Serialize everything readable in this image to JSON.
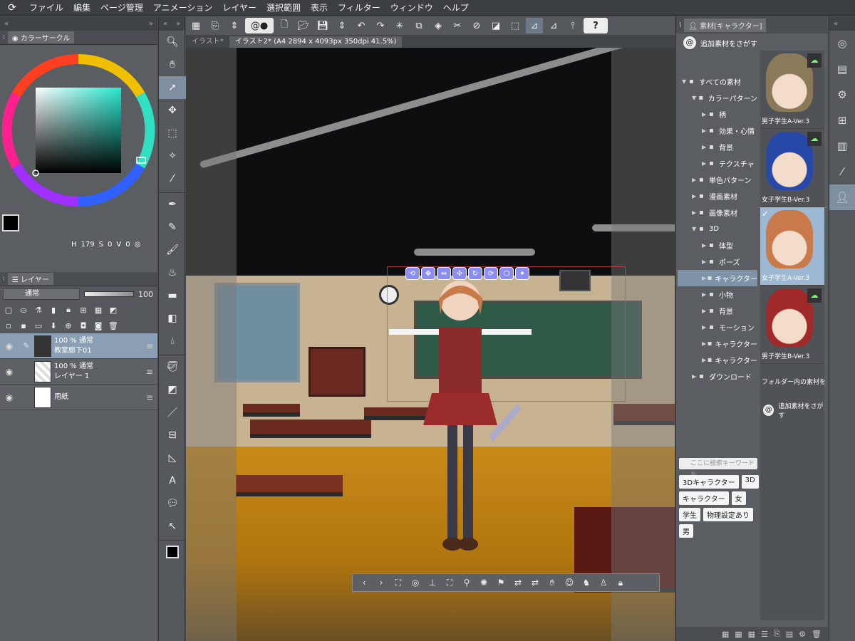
{
  "menu": [
    "ファイル",
    "編集",
    "ページ管理",
    "アニメーション",
    "レイヤー",
    "選択範囲",
    "表示",
    "フィルター",
    "ウィンドウ",
    "ヘルプ"
  ],
  "color_panel": {
    "title": "カラーサークル",
    "h_label": "H",
    "h_value": "179",
    "s_label": "S",
    "s_value": "0",
    "v_label": "V",
    "v_value": "0"
  },
  "layer_panel": {
    "title": "レイヤー",
    "blend_mode": "通常",
    "opacity": "100",
    "layers": [
      {
        "line1": "100 % 通常",
        "line2": "教室廊下01",
        "selected": true
      },
      {
        "line1": "100 % 通常",
        "line2": "レイヤー 1",
        "selected": false
      },
      {
        "line1": "",
        "line2": "用紙",
        "selected": false
      }
    ]
  },
  "tabs": [
    {
      "label": "イラスト*",
      "active": false
    },
    {
      "label": "イラスト2* (A4 2894 x 4093px 350dpi 41.5%)",
      "active": true
    }
  ],
  "material_panel": {
    "title": "素材[キャラクター]",
    "search_more": "追加素材をさがす",
    "tree": [
      {
        "label": "すべての素材",
        "level": 0,
        "selected": false
      },
      {
        "label": "カラーパターン",
        "level": 1,
        "selected": false
      },
      {
        "label": "柄",
        "level": 2,
        "selected": false
      },
      {
        "label": "効果・心情",
        "level": 2,
        "selected": false
      },
      {
        "label": "背景",
        "level": 2,
        "selected": false
      },
      {
        "label": "テクスチャ",
        "level": 2,
        "selected": false
      },
      {
        "label": "単色パターン",
        "level": 1,
        "selected": false
      },
      {
        "label": "漫画素材",
        "level": 1,
        "selected": false
      },
      {
        "label": "画像素材",
        "level": 1,
        "selected": false
      },
      {
        "label": "3D",
        "level": 1,
        "selected": false
      },
      {
        "label": "体型",
        "level": 2,
        "selected": false
      },
      {
        "label": "ポーズ",
        "level": 2,
        "selected": false
      },
      {
        "label": "キャラクター",
        "level": 2,
        "selected": true
      },
      {
        "label": "小物",
        "level": 2,
        "selected": false
      },
      {
        "label": "背景",
        "level": 2,
        "selected": false
      },
      {
        "label": "モーション",
        "level": 2,
        "selected": false
      },
      {
        "label": "キャラクター",
        "level": 2,
        "selected": false
      },
      {
        "label": "キャラクター",
        "level": 2,
        "selected": false
      },
      {
        "label": "ダウンロード",
        "level": 1,
        "selected": false
      }
    ],
    "items": [
      {
        "label": "男子学生A-Ver.3",
        "hair": "#8a7a5a",
        "selected": false
      },
      {
        "label": "女子学生B-Ver.3",
        "hair": "#2848a8",
        "selected": false
      },
      {
        "label": "女子学生A-Ver.3",
        "hair": "#c97a4a",
        "selected": true
      },
      {
        "label": "男子学生B-Ver.3",
        "hair": "#a02a2a",
        "selected": false
      }
    ],
    "folder_link": "フォルダー内の素材をすべ",
    "search_more2": "追加素材をさがす",
    "keyword_placeholder": "ここに検索キーワードを",
    "tags": [
      "3Dキャラクター",
      "3D",
      "キャラクター",
      "女",
      "学生",
      "物理設定あり",
      "男"
    ]
  },
  "colors": {
    "accent": "#7e93a8",
    "wheel_fg": "#000000"
  }
}
